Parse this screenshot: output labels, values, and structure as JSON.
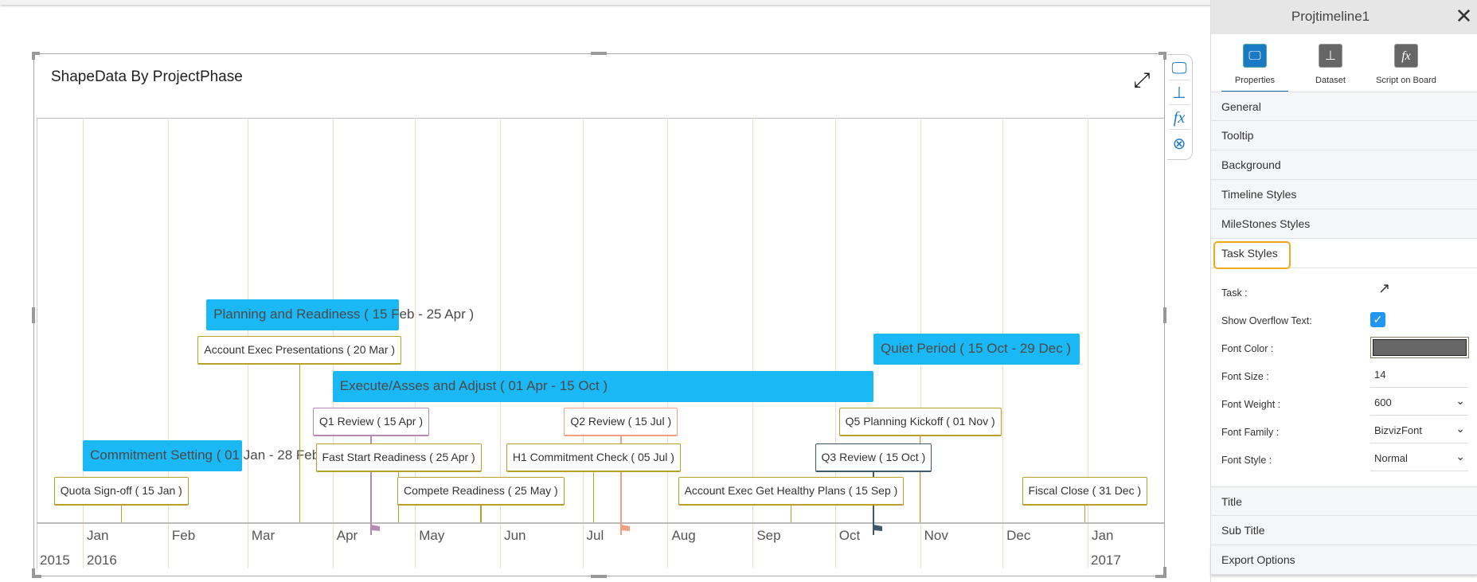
{
  "widget": {
    "title": "ShapeData By ProjectPhase",
    "expand_icon": "expand-icon"
  },
  "chart_data": {
    "type": "timeline",
    "title": "ShapeData By ProjectPhase",
    "x_range": [
      "2015-12-15",
      "2017-01-28"
    ],
    "months": [
      "Jan",
      "Feb",
      "Mar",
      "Apr",
      "May",
      "Jun",
      "Jul",
      "Aug",
      "Sep",
      "Oct",
      "Nov",
      "Dec",
      "Jan"
    ],
    "years": [
      "2015",
      "2016",
      "2017"
    ],
    "tasks": [
      {
        "label": "Planning and Readiness ( 15 Feb - 25 Apr )",
        "start": "2016-02-15",
        "end": "2016-04-25"
      },
      {
        "label": "Execute/Asses and Adjust ( 01 Apr - 15 Oct )",
        "start": "2016-04-01",
        "end": "2016-10-15"
      },
      {
        "label": "Quiet Period ( 15 Oct - 29 Dec )",
        "start": "2016-10-15",
        "end": "2016-12-29"
      },
      {
        "label": "Commitment Setting ( 01 Jan - 28 Feb )",
        "start": "2016-01-01",
        "end": "2016-02-28"
      }
    ],
    "milestones": [
      {
        "label": "Account Exec Presentations ( 20 Mar )",
        "date": "2016-03-20",
        "color": "#b8a02a"
      },
      {
        "label": "Q1 Review ( 15 Apr )",
        "date": "2016-04-15",
        "color": "#b58bb5"
      },
      {
        "label": "Q2 Review ( 15 Jul )",
        "date": "2016-07-15",
        "color": "#f0a080"
      },
      {
        "label": "Q5 Planning Kickoff ( 01 Nov )",
        "date": "2016-11-01",
        "color": "#b8a02a"
      },
      {
        "label": "Fast Start Readiness ( 25 Apr )",
        "date": "2016-04-25",
        "color": "#b8a02a"
      },
      {
        "label": "H1 Commitment Check ( 05 Jul )",
        "date": "2016-07-05",
        "color": "#b8a02a"
      },
      {
        "label": "Q3 Review ( 15 Oct )",
        "date": "2016-10-15",
        "color": "#3d5a6c"
      },
      {
        "label": "Quota Sign-off ( 15 Jan )",
        "date": "2016-01-15",
        "color": "#b8a02a"
      },
      {
        "label": "Compete Readiness ( 25 May )",
        "date": "2016-05-25",
        "color": "#b8a02a"
      },
      {
        "label": "Account Exec Get Healthy Plans ( 15 Sep )",
        "date": "2016-09-15",
        "color": "#b8a02a"
      },
      {
        "label": "Fiscal Close ( 31 Dec )",
        "date": "2016-12-31",
        "color": "#b8a02a"
      }
    ],
    "bar_color": "#1ab8f5"
  },
  "panel": {
    "title": "Projtimeline1",
    "tabs": [
      {
        "label": "Properties",
        "icon": "fx"
      },
      {
        "label": "Dataset"
      },
      {
        "label": "Script on Board",
        "icon_text": "fx"
      }
    ],
    "sections_top": [
      "General",
      "Tooltip",
      "Background",
      "Timeline Styles",
      "MileStones Styles",
      "Task Styles"
    ],
    "fields": {
      "task": "Task :",
      "overflow": "Show Overflow Text:",
      "font_color": "Font Color :",
      "font_color_value": "#666666",
      "font_size": "Font Size :",
      "font_size_value": "14",
      "font_weight": "Font Weight :",
      "font_weight_value": "600",
      "font_family": "Font Family :",
      "font_family_value": "BizvizFont",
      "font_style": "Font Style :",
      "font_style_value": "Normal"
    },
    "sections_bottom": [
      "Title",
      "Sub Title",
      "Export Options"
    ]
  }
}
